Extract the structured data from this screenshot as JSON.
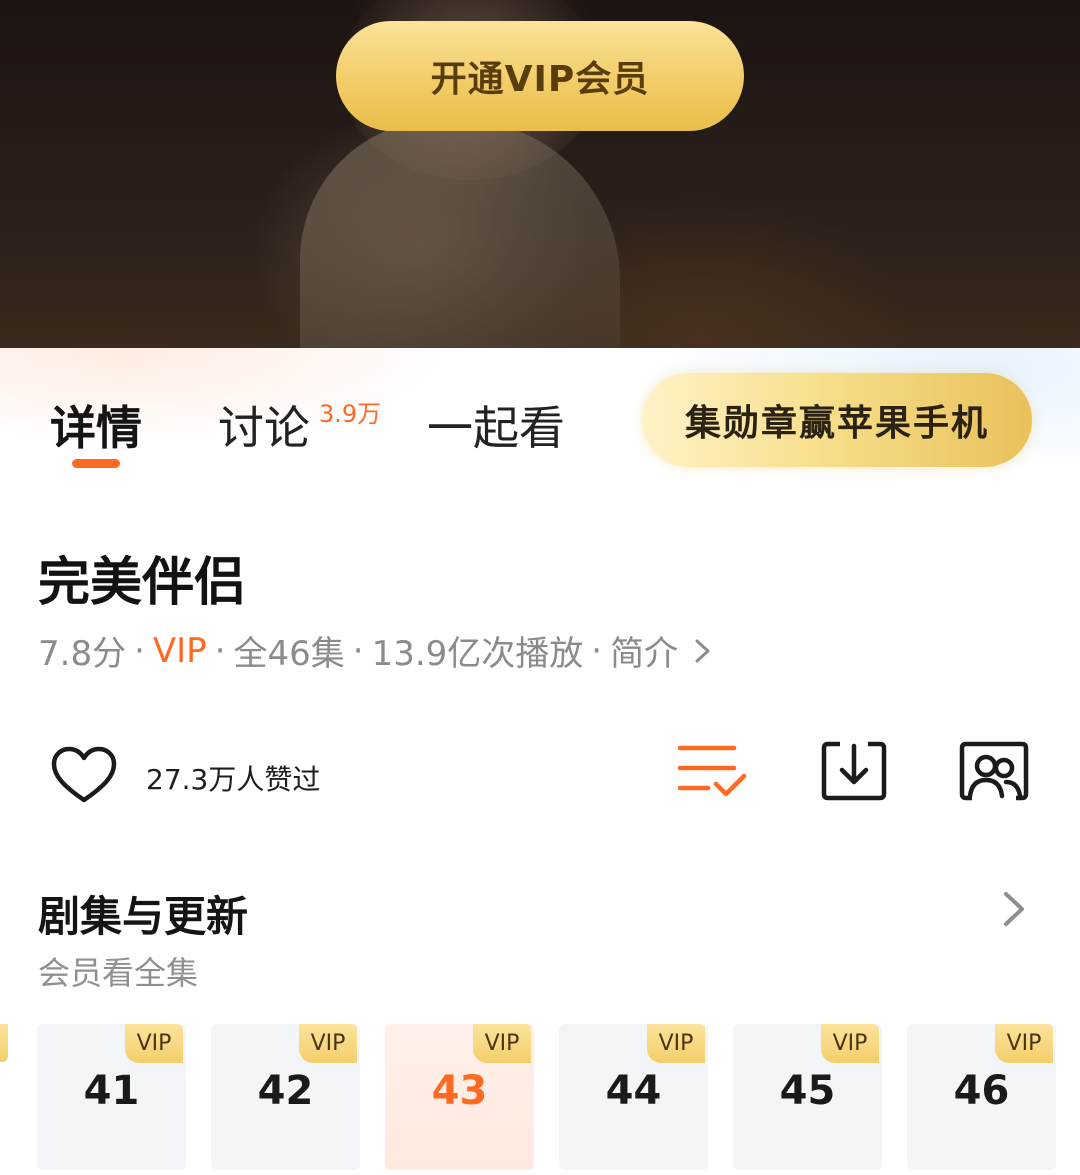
{
  "hero": {
    "vip_button_label": "开通VIP会员"
  },
  "tabs": {
    "detail_label": "详情",
    "discuss_label": "讨论",
    "discuss_count": "3.9万",
    "watch_together_label": "一起看",
    "medal_button_label": "集勋章赢苹果手机"
  },
  "show": {
    "title": "完美伴侣",
    "score": "7.8分",
    "vip": "VIP",
    "episodes": "全46集",
    "plays": "13.9亿次播放",
    "intro": "简介",
    "separator": "·"
  },
  "actions": {
    "likes_text": "27.3万人赞过",
    "icons": [
      "heart-icon",
      "playlist-add-icon",
      "download-icon",
      "watch-together-icon"
    ]
  },
  "episodes_section": {
    "title": "剧集与更新",
    "subtitle": "会员看全集",
    "badge": "VIP",
    "items": [
      "41",
      "42",
      "43",
      "44",
      "45",
      "46"
    ],
    "active": "43"
  },
  "colors": {
    "accent": "#ff6a22",
    "gold": "#f2cd68",
    "text": "#141414",
    "muted": "#8b8b8f"
  }
}
